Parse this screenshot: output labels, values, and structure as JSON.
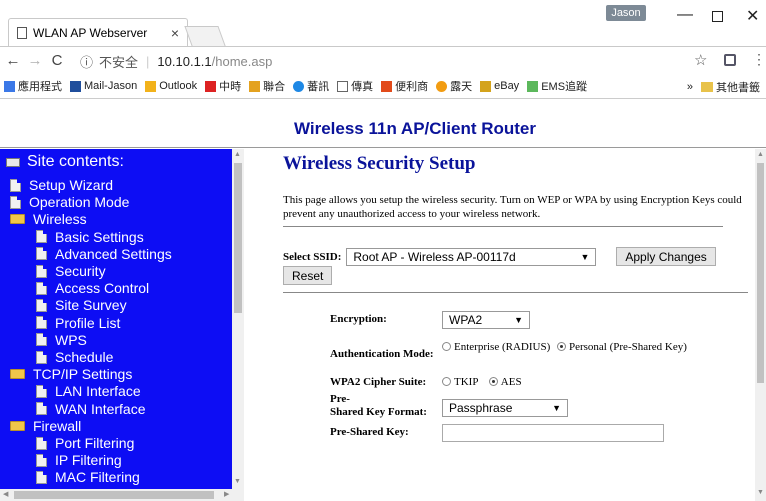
{
  "browser": {
    "tab_title": "WLAN AP Webserver",
    "tab_close": "×",
    "user_badge": "Jason",
    "url_security": "不安全",
    "url_host": "10.10.1.1",
    "url_path": "/home.asp",
    "bookmarks": [
      "應用程式",
      "Mail-Jason",
      "Outlook",
      "中時",
      "聯合",
      "蕃訊",
      "傳真",
      "便利商",
      "露天",
      "eBay",
      "EMS追蹤"
    ],
    "more_bookmarks": "»",
    "other_bookmarks": "其他書籤"
  },
  "header": {
    "title": "Wireless 11n AP/Client Router"
  },
  "sidebar": {
    "heading": "Site contents:",
    "items": [
      {
        "label": "Setup Wizard",
        "type": "page",
        "level": 0
      },
      {
        "label": "Operation Mode",
        "type": "page",
        "level": 0
      },
      {
        "label": "Wireless",
        "type": "folder",
        "level": 0
      },
      {
        "label": "Basic Settings",
        "type": "page",
        "level": 1
      },
      {
        "label": "Advanced Settings",
        "type": "page",
        "level": 1
      },
      {
        "label": "Security",
        "type": "page",
        "level": 1
      },
      {
        "label": "Access Control",
        "type": "page",
        "level": 1
      },
      {
        "label": "Site Survey",
        "type": "page",
        "level": 1
      },
      {
        "label": "Profile List",
        "type": "page",
        "level": 1
      },
      {
        "label": "WPS",
        "type": "page",
        "level": 1
      },
      {
        "label": "Schedule",
        "type": "page",
        "level": 1
      },
      {
        "label": "TCP/IP Settings",
        "type": "folder",
        "level": 0
      },
      {
        "label": "LAN Interface",
        "type": "page",
        "level": 1
      },
      {
        "label": "WAN Interface",
        "type": "page",
        "level": 1
      },
      {
        "label": "Firewall",
        "type": "folder",
        "level": 0
      },
      {
        "label": "Port Filtering",
        "type": "page",
        "level": 1
      },
      {
        "label": "IP Filtering",
        "type": "page",
        "level": 1
      },
      {
        "label": "MAC Filtering",
        "type": "page",
        "level": 1
      }
    ]
  },
  "main": {
    "title": "Wireless Security Setup",
    "description": "This page allows you setup the wireless security. Turn on WEP or WPA by using Encryption Keys could prevent any unauthorized access to your wireless network.",
    "ssid_label": "Select SSID:",
    "ssid_value": "Root AP - Wireless AP-00117d",
    "apply_button": "Apply Changes",
    "reset_button": "Reset",
    "encryption_label": "Encryption:",
    "encryption_value": "WPA2",
    "auth_label": "Authentication Mode:",
    "auth_options": [
      "Enterprise (RADIUS)",
      "Personal (Pre-Shared Key)"
    ],
    "auth_selected": "Personal (Pre-Shared Key)",
    "cipher_label": "WPA2 Cipher Suite:",
    "cipher_options": [
      "TKIP",
      "AES"
    ],
    "cipher_selected": "AES",
    "psk_format_label_1": "Pre-",
    "psk_format_label_2": "Shared Key Format:",
    "psk_format_value": "Passphrase",
    "psk_label": "Pre-Shared Key:",
    "psk_value": ""
  },
  "colors": {
    "nav_bg": "#0d0df4",
    "heading_blue": "#0a139a"
  }
}
